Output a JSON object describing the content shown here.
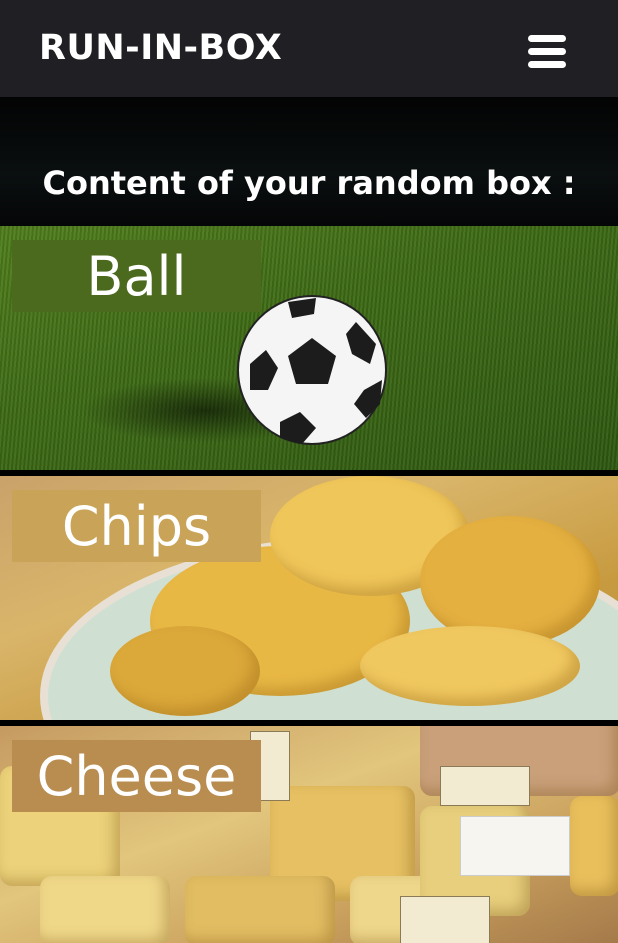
{
  "navbar": {
    "brand": "RUN-IN-BOX",
    "menu_icon": "hamburger-menu-icon"
  },
  "intro": {
    "title": "Content of your random box :"
  },
  "items": [
    {
      "label": "Ball"
    },
    {
      "label": "Chips"
    },
    {
      "label": "Cheese"
    }
  ],
  "colors": {
    "navbar": "#202024",
    "ball_label_bg": "#4c6a1e",
    "chips_label_bg": "#c9a458",
    "cheese_label_bg": "#b98c50"
  }
}
